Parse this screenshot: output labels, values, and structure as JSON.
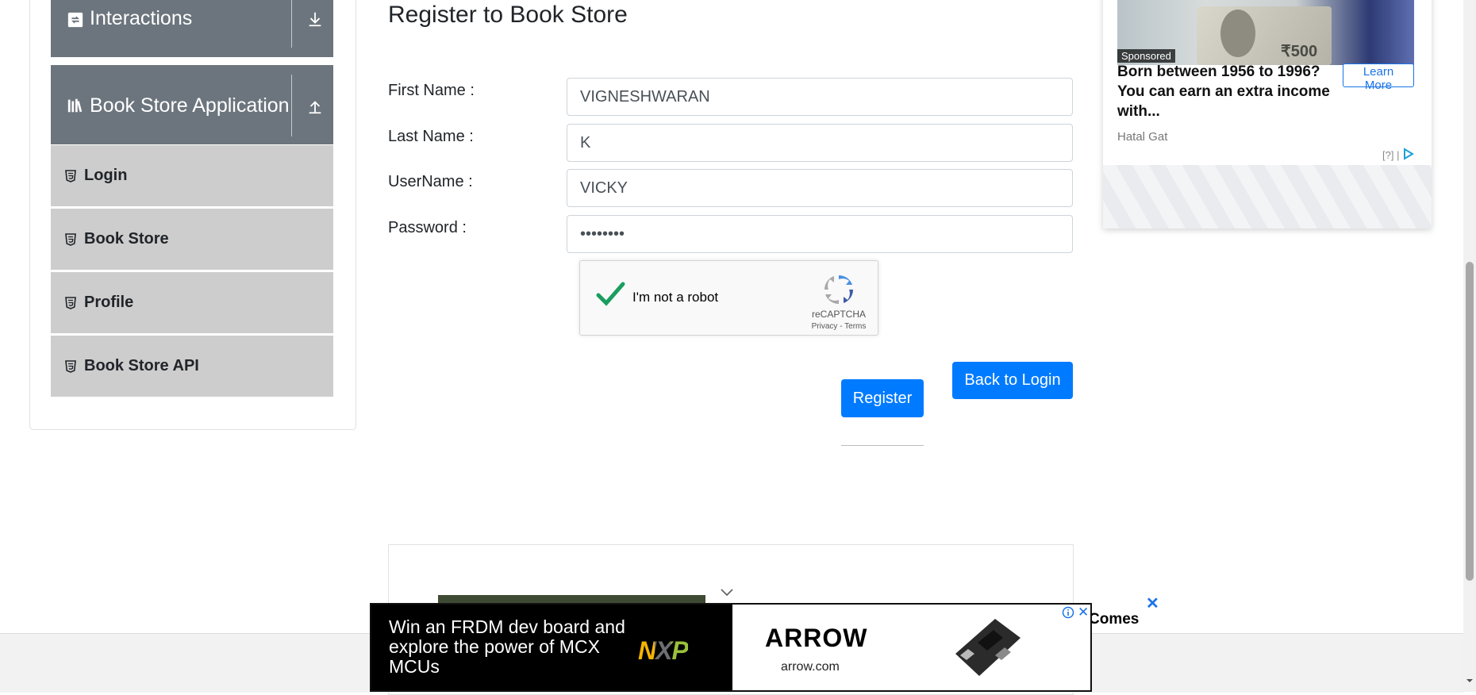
{
  "sidebar": {
    "groups": [
      {
        "label": "Interactions",
        "icon": "interactions-icon",
        "toggle": "expand-icon"
      },
      {
        "label": "Book Store Application",
        "icon": "bookshelf-icon",
        "toggle": "collapse-icon"
      }
    ],
    "items": [
      {
        "label": "Login",
        "icon": "html5-icon"
      },
      {
        "label": "Book Store",
        "icon": "html5-icon"
      },
      {
        "label": "Profile",
        "icon": "html5-icon"
      },
      {
        "label": "Book Store API",
        "icon": "html5-icon"
      }
    ]
  },
  "form": {
    "title": "Register to Book Store",
    "fields": [
      {
        "label": "First Name :",
        "value": "VIGNESHWARAN"
      },
      {
        "label": "Last Name :",
        "value": "K"
      },
      {
        "label": "UserName :",
        "value": "VICKY"
      },
      {
        "label": "Password :",
        "value": "••••••••"
      }
    ],
    "captcha": {
      "label": "I'm not a robot",
      "brand": "reCAPTCHA",
      "links": "Privacy - Terms",
      "checked": true
    },
    "register_label": "Register",
    "back_label": "Back to Login"
  },
  "side_ad": {
    "sponsored": "Sponsored",
    "note_text": "₹500",
    "headline": "Born between 1956 to 1996? You can earn an extra income with...",
    "advertiser": "Hatal Gat",
    "cta": "Learn More",
    "info": "[?] |"
  },
  "bottom_ad": {
    "copy": "Win an FRDM dev board and explore the power of MCX MCUs",
    "brand": "NXP",
    "partner": "ARROW",
    "url": "arrow.com",
    "trailing_text": "Comes",
    "close": "✕"
  },
  "colors": {
    "primary": "#007bff",
    "sidebar_header": "#6c757d",
    "menu_item": "#cdcdcd",
    "captcha_check": "#1a9e5f"
  }
}
